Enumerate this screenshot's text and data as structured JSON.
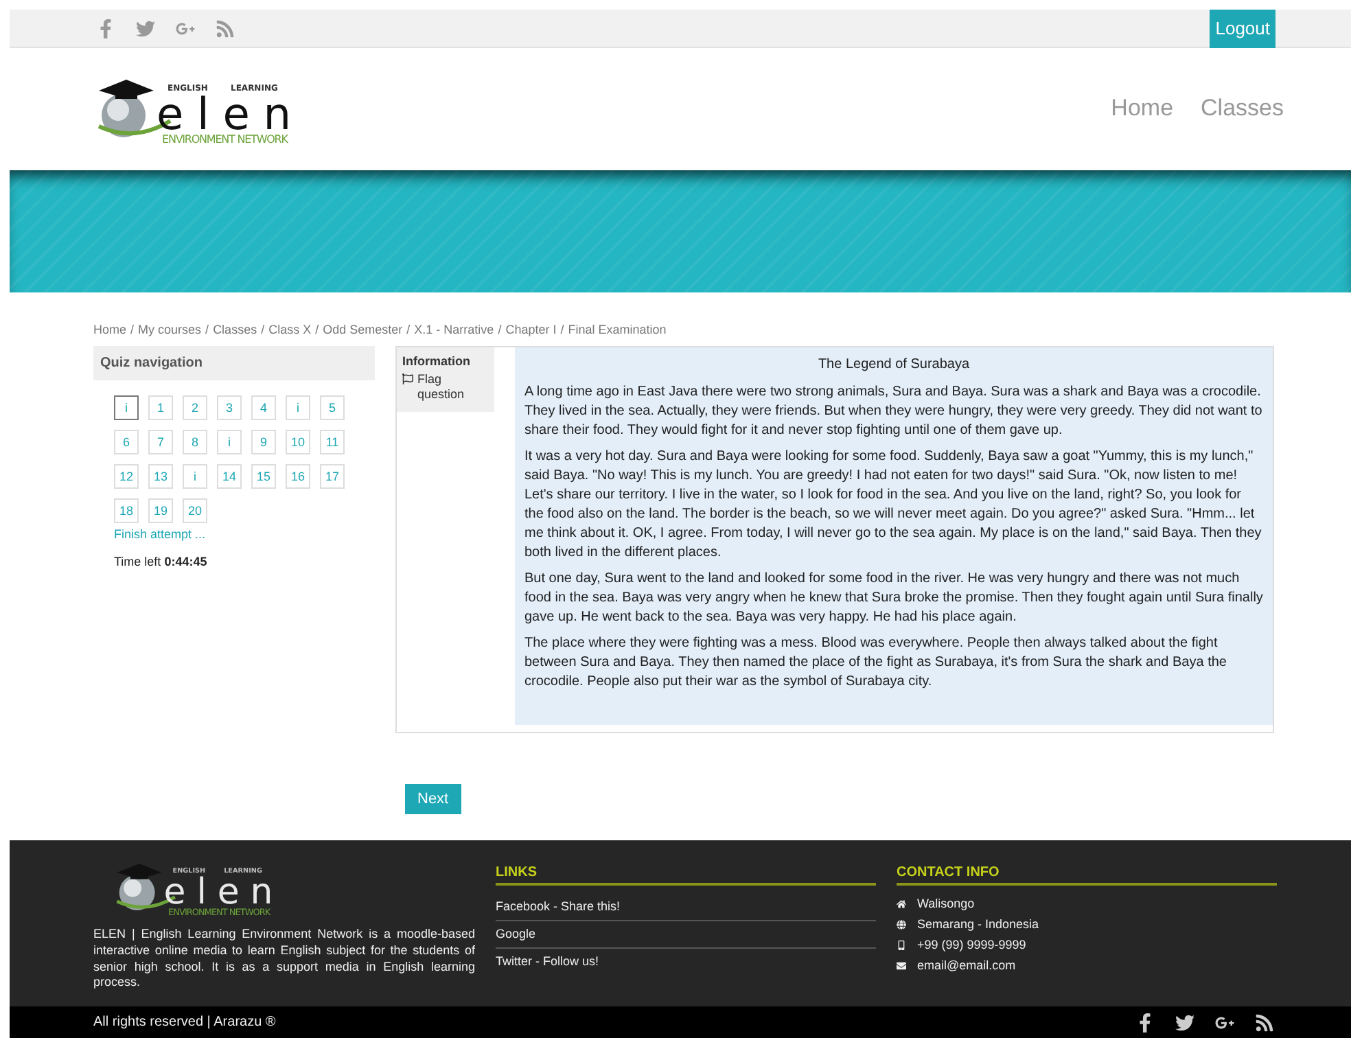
{
  "top_bar": {
    "social": [
      {
        "kind": "facebook"
      },
      {
        "kind": "twitter"
      },
      {
        "kind": "googleplus"
      },
      {
        "kind": "rss"
      }
    ],
    "logout": "Logout"
  },
  "logo": {
    "top_left": "ENGLISH",
    "top_right": "LEARNING",
    "word": "elen",
    "bottom": "ENVIRONMENT NETWORK"
  },
  "nav": [
    "Home",
    "Classes"
  ],
  "breadcrumb_separator": "/",
  "breadcrumb": [
    "Home",
    "My courses",
    "Classes",
    "Class X",
    "Odd Semester",
    "X.1 - Narrative",
    "Chapter I",
    "Final Examination"
  ],
  "quiz_navigation": {
    "title": "Quiz navigation",
    "items": [
      {
        "label": "i",
        "selected": true
      },
      {
        "label": "1",
        "selected": false
      },
      {
        "label": "2",
        "selected": false
      },
      {
        "label": "3",
        "selected": false
      },
      {
        "label": "4",
        "selected": false
      },
      {
        "label": "i",
        "selected": false
      },
      {
        "label": "5",
        "selected": false
      },
      {
        "label": "6",
        "selected": false
      },
      {
        "label": "7",
        "selected": false
      },
      {
        "label": "8",
        "selected": false
      },
      {
        "label": "i",
        "selected": false
      },
      {
        "label": "9",
        "selected": false
      },
      {
        "label": "10",
        "selected": false
      },
      {
        "label": "11",
        "selected": false
      },
      {
        "label": "12",
        "selected": false
      },
      {
        "label": "13",
        "selected": false
      },
      {
        "label": "i",
        "selected": false
      },
      {
        "label": "14",
        "selected": false
      },
      {
        "label": "15",
        "selected": false
      },
      {
        "label": "16",
        "selected": false
      },
      {
        "label": "17",
        "selected": false
      },
      {
        "label": "18",
        "selected": false
      },
      {
        "label": "19",
        "selected": false
      },
      {
        "label": "20",
        "selected": false
      }
    ],
    "finish": "Finish attempt ...",
    "time_left": "Time left **0:44:45**"
  },
  "question": {
    "info_title": "Information",
    "flag": "Flag question",
    "title": "The Legend of Surabaya",
    "paragraphs": [
      " A long time ago in East Java there were two strong animals, Sura and Baya. Sura was a shark and Baya was a crocodile. They lived in the sea. Actually, they were friends. But when they were hungry, they were very greedy. They did not want to share their food. They would fight for it and never stop fighting until one of them gave up.",
      "It was a very hot day. Sura and Baya were looking for some food. Suddenly, Baya saw a goat \"Yummy, this is my lunch,\" said Baya. \"No way! This is my lunch. You are greedy! I had not eaten for two days!\" said Sura. \"Ok, now listen to me! Let's share our territory. I live in the water, so I look for food in the sea. And you live on the land, right? So, you look for the food also on the land. The border is the beach, so we will never meet again. Do you agree?\" asked Sura. \"Hmm... let me think about it. OK, I agree. From today, I will never go to the sea again. My place is on the land,\" said Baya. Then they both lived in the different places.",
      "But one day, Sura went to the land and looked for some food in the river. He was very hungry and there was not much food in the sea. Baya was very angry when he knew that Sura broke the promise. Then they fought again until Sura finally gave up. He went back to the sea. Baya was very happy. He had his place again.",
      "The place where they were fighting was a mess. Blood was everywhere. People then always talked about the fight between Sura and Baya. They then named the place of the fight as Surabaya, it's from Sura the shark and Baya the crocodile. People also put their war as the symbol of Surabaya city."
    ]
  },
  "next": "Next",
  "footer": {
    "logo": {
      "top_left": "ENGLISH",
      "top_right": "LEARNING",
      "word": "elen",
      "bottom": "ENVIRONMENT NETWORK"
    },
    "about": "ELEN | English Learning Environment Network is a moodle-based interactive online media to learn English subject for the students of senior high school. It is as a support media in English learning process.",
    "links_title": "LINKS",
    "links": [
      "Facebook - Share this!",
      "Google",
      "Twitter - Follow us!"
    ],
    "contact_title": "CONTACT INFO",
    "contact": [
      {
        "kind": "home",
        "text": "Walisongo"
      },
      {
        "kind": "globe",
        "text": "Semarang - Indonesia"
      },
      {
        "kind": "phone",
        "text": "+99 (99) 9999-9999"
      },
      {
        "kind": "email",
        "text": "email@email.com"
      }
    ],
    "copyright": "All rights reserved | Ararazu ®",
    "social": [
      {
        "kind": "facebook"
      },
      {
        "kind": "twitter"
      },
      {
        "kind": "googleplus"
      },
      {
        "kind": "rss"
      }
    ]
  }
}
